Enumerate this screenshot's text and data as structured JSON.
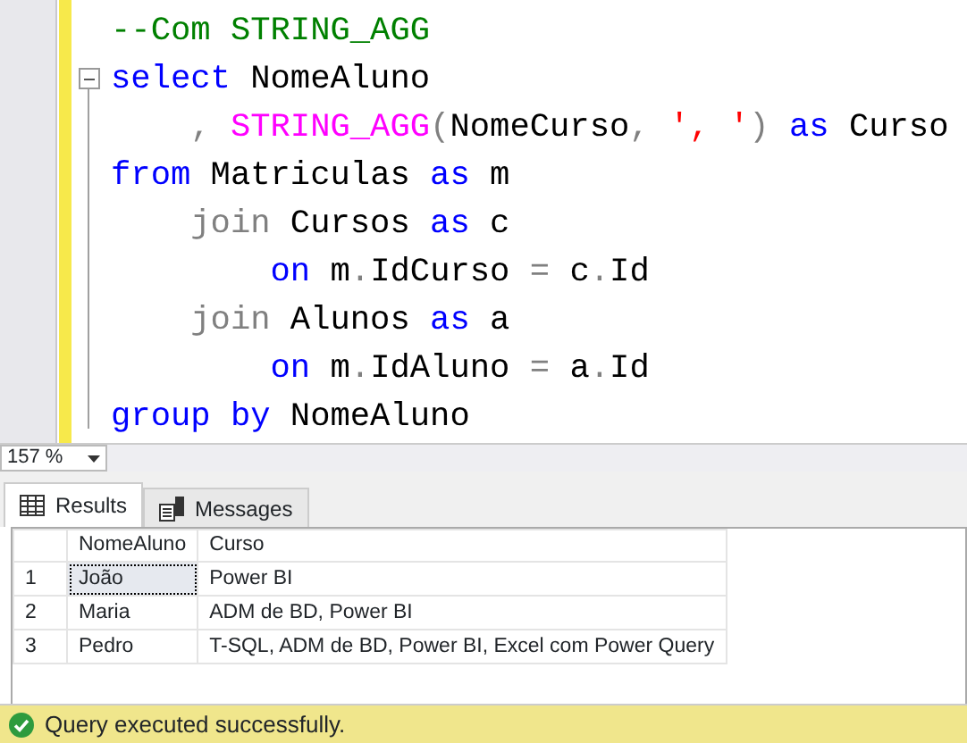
{
  "editor": {
    "lines": [
      {
        "fold": false,
        "tokens": [
          {
            "kind": "comment",
            "text": "--Com STRING_AGG"
          }
        ]
      },
      {
        "fold": true,
        "tokens": [
          {
            "kind": "keyword",
            "text": "select"
          },
          {
            "kind": "plain",
            "text": " NomeAluno"
          }
        ]
      },
      {
        "fold": false,
        "tokens": [
          {
            "kind": "operator",
            "text": "    , "
          },
          {
            "kind": "function",
            "text": "STRING_AGG"
          },
          {
            "kind": "operator",
            "text": "("
          },
          {
            "kind": "plain",
            "text": "NomeCurso"
          },
          {
            "kind": "operator",
            "text": ", "
          },
          {
            "kind": "string",
            "text": "', '"
          },
          {
            "kind": "operator",
            "text": ") "
          },
          {
            "kind": "keyword",
            "text": "as"
          },
          {
            "kind": "plain",
            "text": " Curso"
          }
        ]
      },
      {
        "fold": false,
        "tokens": [
          {
            "kind": "keyword",
            "text": "from"
          },
          {
            "kind": "plain",
            "text": " Matriculas "
          },
          {
            "kind": "keyword",
            "text": "as"
          },
          {
            "kind": "plain",
            "text": " m"
          }
        ]
      },
      {
        "fold": false,
        "tokens": [
          {
            "kind": "operator",
            "text": "    join"
          },
          {
            "kind": "plain",
            "text": " Cursos "
          },
          {
            "kind": "keyword",
            "text": "as"
          },
          {
            "kind": "plain",
            "text": " c"
          }
        ]
      },
      {
        "fold": false,
        "tokens": [
          {
            "kind": "keyword",
            "text": "        on"
          },
          {
            "kind": "plain",
            "text": " m"
          },
          {
            "kind": "operator",
            "text": "."
          },
          {
            "kind": "plain",
            "text": "IdCurso "
          },
          {
            "kind": "operator",
            "text": "="
          },
          {
            "kind": "plain",
            "text": " c"
          },
          {
            "kind": "operator",
            "text": "."
          },
          {
            "kind": "plain",
            "text": "Id"
          }
        ]
      },
      {
        "fold": false,
        "tokens": [
          {
            "kind": "operator",
            "text": "    join"
          },
          {
            "kind": "plain",
            "text": " Alunos "
          },
          {
            "kind": "keyword",
            "text": "as"
          },
          {
            "kind": "plain",
            "text": " a"
          }
        ]
      },
      {
        "fold": false,
        "tokens": [
          {
            "kind": "keyword",
            "text": "        on"
          },
          {
            "kind": "plain",
            "text": " m"
          },
          {
            "kind": "operator",
            "text": "."
          },
          {
            "kind": "plain",
            "text": "IdAluno "
          },
          {
            "kind": "operator",
            "text": "="
          },
          {
            "kind": "plain",
            "text": " a"
          },
          {
            "kind": "operator",
            "text": "."
          },
          {
            "kind": "plain",
            "text": "Id"
          }
        ]
      },
      {
        "fold": false,
        "tokens": [
          {
            "kind": "keyword",
            "text": "group by"
          },
          {
            "kind": "plain",
            "text": " NomeAluno"
          }
        ]
      }
    ]
  },
  "zoom": "157 %",
  "tabs": [
    {
      "label": "Results",
      "kind": "grid",
      "selected": true
    },
    {
      "label": "Messages",
      "kind": "messages",
      "selected": false
    }
  ],
  "grid": {
    "columns": [
      "NomeAluno",
      "Curso"
    ],
    "rows": [
      {
        "number": "1",
        "cells": [
          "João",
          "Power BI"
        ],
        "focused": true
      },
      {
        "number": "2",
        "cells": [
          "Maria",
          "ADM de BD, Power BI"
        ],
        "focused": false
      },
      {
        "number": "3",
        "cells": [
          "Pedro",
          "T-SQL, ADM de BD, Power BI, Excel com Power Query"
        ],
        "focused": false
      }
    ]
  },
  "status": "Query executed successfully."
}
